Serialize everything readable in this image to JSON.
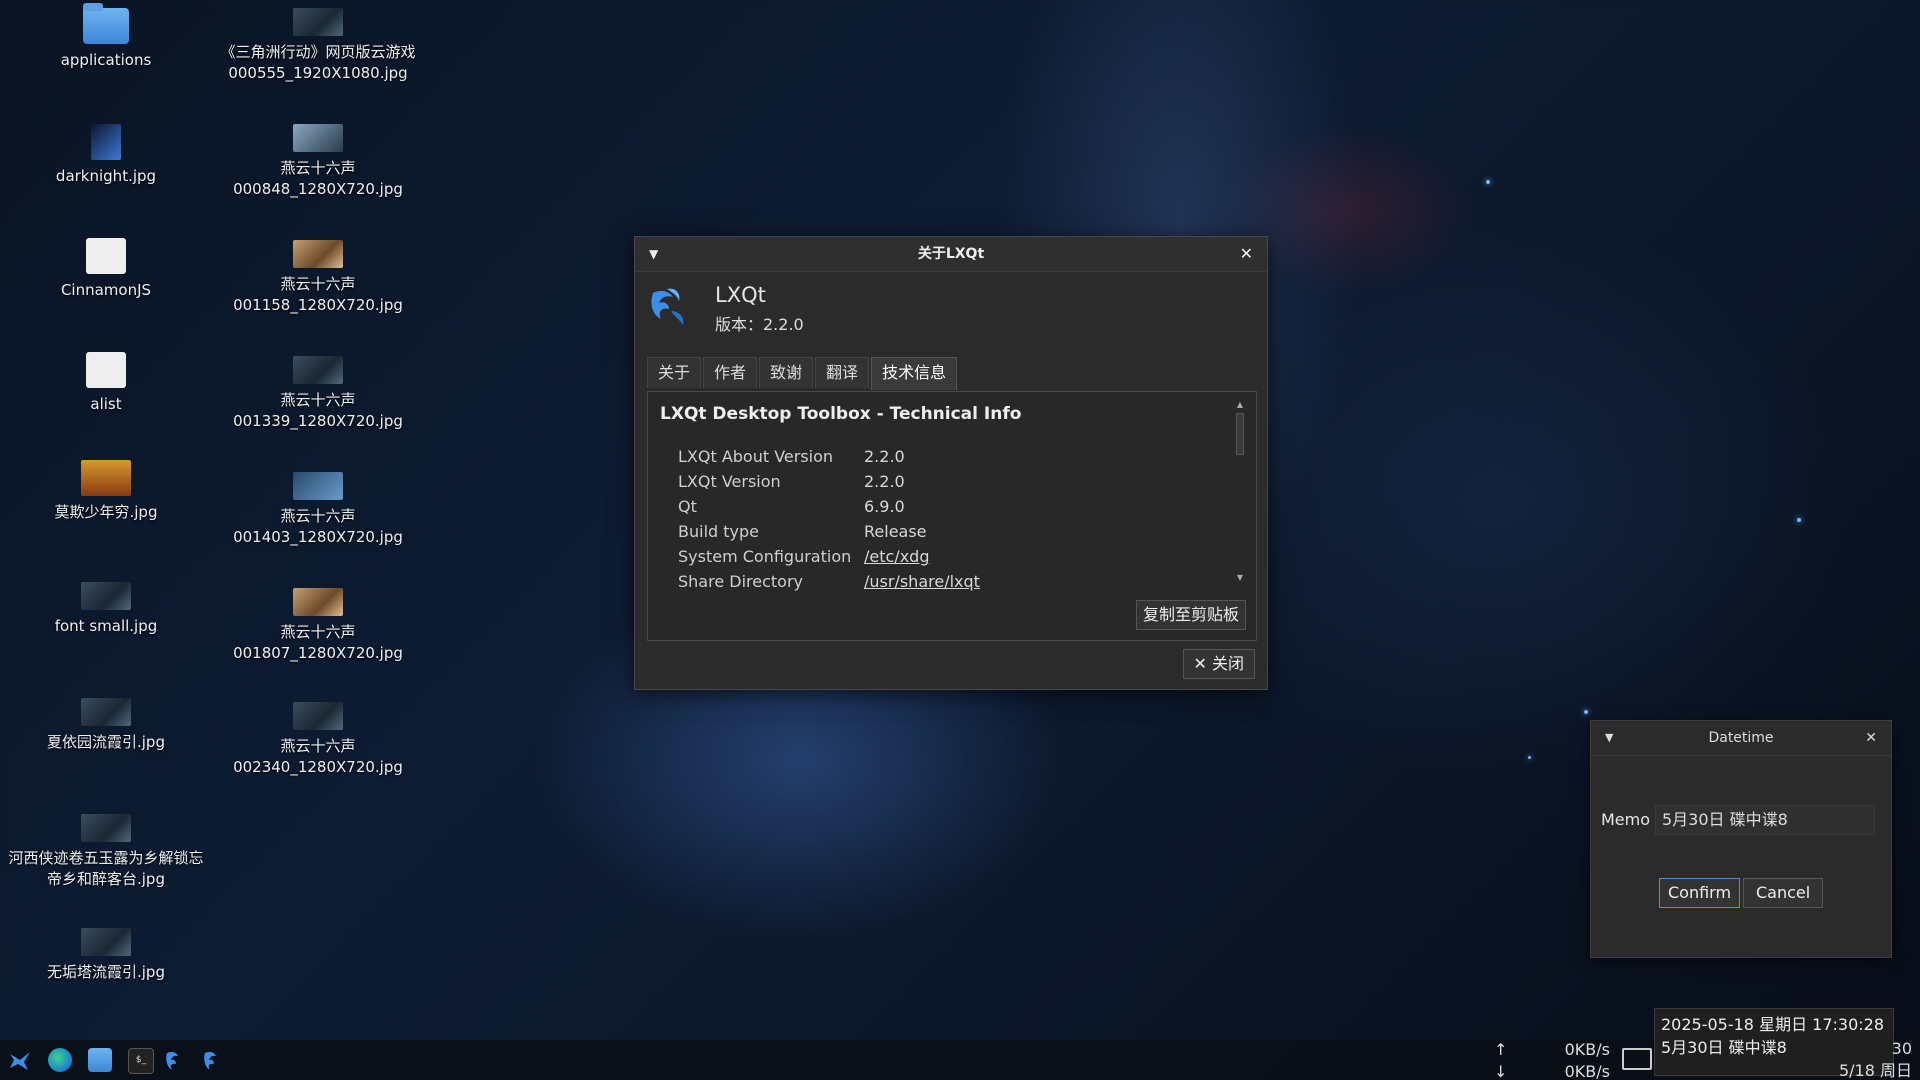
{
  "desktop": {
    "col1": [
      {
        "label": "applications",
        "kind": "folder"
      },
      {
        "label": "darknight.jpg",
        "kind": "image"
      },
      {
        "label": "CinnamonJS",
        "kind": "doc"
      },
      {
        "label": "alist",
        "kind": "doc"
      },
      {
        "label": "莫欺少年穷.jpg",
        "kind": "poster"
      },
      {
        "label": "font small.jpg",
        "kind": "image"
      },
      {
        "label": "夏依园流霞引.jpg",
        "kind": "image"
      },
      {
        "label_l1": "河西侠迹卷五玉露为乡解锁忘",
        "label_l2": "帝乡和醉客台.jpg",
        "kind": "image"
      },
      {
        "label": "无垢塔流霞引.jpg",
        "kind": "image"
      }
    ],
    "col2": [
      {
        "label_l1": "《三角洲行动》网页版云游戏",
        "label_l2": "000555_1920X1080.jpg"
      },
      {
        "label_l1": "燕云十六声",
        "label_l2": "000848_1280X720.jpg"
      },
      {
        "label_l1": "燕云十六声",
        "label_l2": "001158_1280X720.jpg"
      },
      {
        "label_l1": "燕云十六声",
        "label_l2": "001339_1280X720.jpg"
      },
      {
        "label_l1": "燕云十六声",
        "label_l2": "001403_1280X720.jpg"
      },
      {
        "label_l1": "燕云十六声",
        "label_l2": "001807_1280X720.jpg"
      },
      {
        "label_l1": "燕云十六声",
        "label_l2": "002340_1280X720.jpg"
      }
    ]
  },
  "about_dialog": {
    "title": "关于LXQt",
    "menu_icon": "▼",
    "close_icon": "✕",
    "app_name": "LXQt",
    "version_line": "版本：2.2.0",
    "tabs": [
      "关于",
      "作者",
      "致谢",
      "翻译",
      "技术信息"
    ],
    "active_tab": "技术信息",
    "heading": "LXQt Desktop Toolbox - Technical Info",
    "info": [
      {
        "key": "LXQt About Version",
        "value": "2.2.0"
      },
      {
        "key": "LXQt Version",
        "value": "2.2.0"
      },
      {
        "key": "Qt",
        "value": "6.9.0"
      },
      {
        "key": "Build type",
        "value": "Release"
      },
      {
        "key": "System Configuration",
        "value": "/etc/xdg"
      },
      {
        "key": "Share Directory",
        "value": "/usr/share/lxqt"
      }
    ],
    "copy_button": "复制至剪贴板",
    "close_button": "✕ 关闭"
  },
  "datetime_dialog": {
    "title": "Datetime",
    "memo_label": "Memo",
    "memo_value": "5月30日 碟中谍8",
    "confirm": "Confirm",
    "cancel": "Cancel"
  },
  "taskbar": {
    "net_up": "0KB/s",
    "net_down": "0KB/s",
    "tooltip_line1": "2025-05-18 星期日 17:30:28",
    "tooltip_line2": "5月30日 碟中谍8",
    "clock_time": "30",
    "clock_date": "5/18 周日"
  },
  "colors": {
    "accent": "#4ea2ff",
    "dialog_bg": "#2b2b2b"
  }
}
